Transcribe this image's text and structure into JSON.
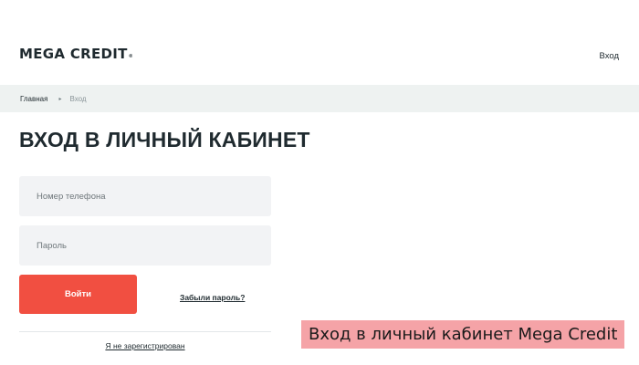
{
  "header": {
    "logo_text": "MEGA CREDIT",
    "logo_reg": "®",
    "login_link": "Вход"
  },
  "breadcrumb": {
    "home": "Главная",
    "separator": "▸",
    "current": "Вход"
  },
  "main": {
    "title": "ВХОД В ЛИЧНЫЙ КАБИНЕТ",
    "phone_placeholder": "Номер телефона",
    "password_placeholder": "Пароль",
    "submit_label": "Войти",
    "forgot_label": "Забыли пароль?",
    "register_label": "Я не зарегистрирован"
  },
  "caption": "Вход в личный кабинет Mega Credit",
  "colors": {
    "accent": "#f14f41",
    "breadcrumb_bg": "#eef2f1",
    "input_bg": "#f2f3f5",
    "caption_bg": "#f5a3a7",
    "text": "#1f2a2f"
  }
}
